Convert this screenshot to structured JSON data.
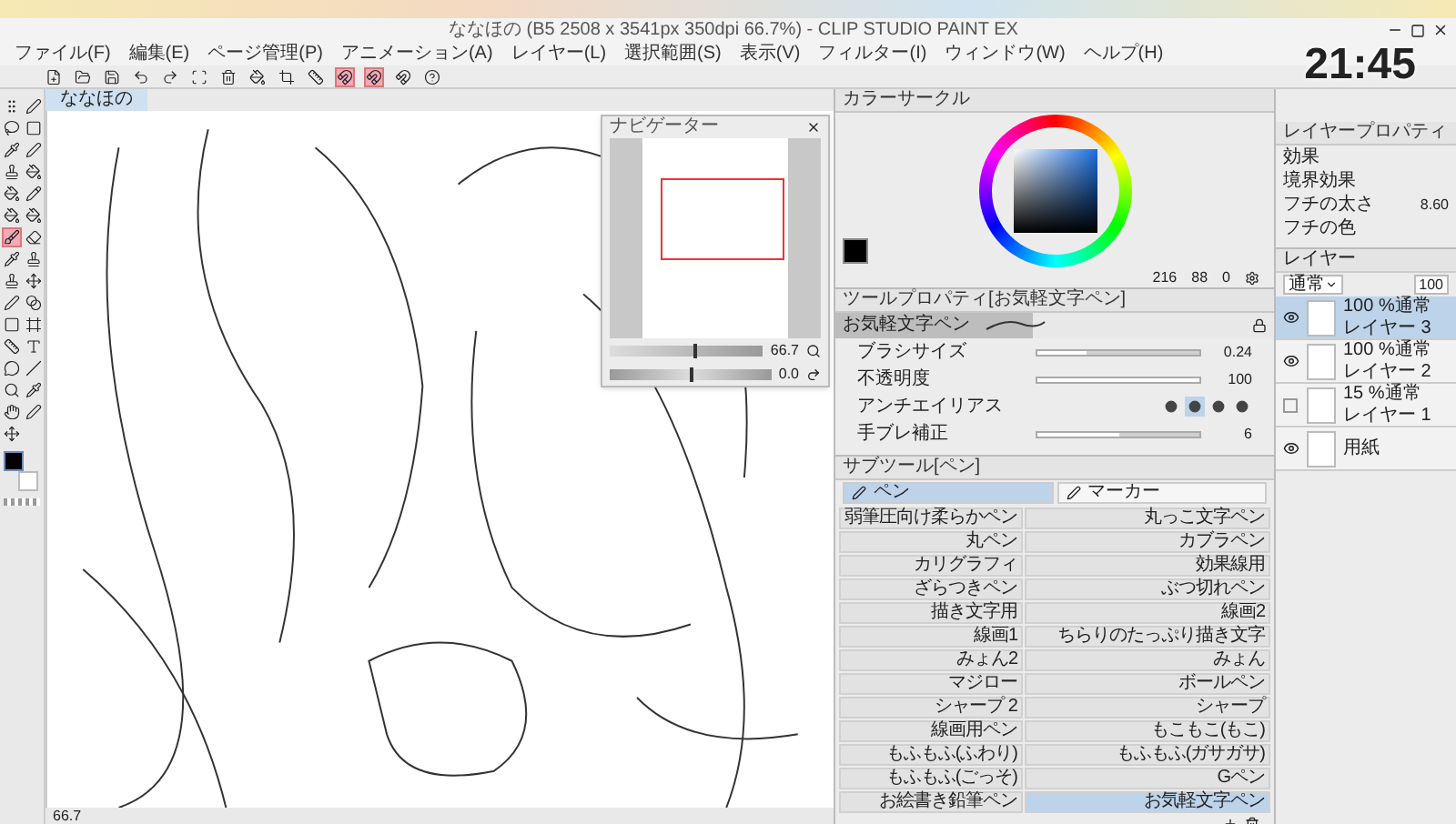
{
  "window": {
    "title": "ななほの (B5 2508 x 3541px 350dpi 66.7%) - CLIP STUDIO PAINT EX"
  },
  "clock": "21:45",
  "menu": [
    "ファイル(F)",
    "編集(E)",
    "ページ管理(P)",
    "アニメーション(A)",
    "レイヤー(L)",
    "選択範囲(S)",
    "表示(V)",
    "フィルター(I)",
    "ウィンドウ(W)",
    "ヘルプ(H)"
  ],
  "toolbar": [
    {
      "kind": "new",
      "selected": false
    },
    {
      "kind": "open",
      "selected": false
    },
    {
      "kind": "save",
      "selected": false
    },
    {
      "kind": "undo",
      "selected": false
    },
    {
      "kind": "redo",
      "selected": false
    },
    {
      "kind": "transform",
      "selected": false
    },
    {
      "kind": "clear",
      "selected": false
    },
    {
      "kind": "fill",
      "selected": false
    },
    {
      "kind": "crop",
      "selected": false
    },
    {
      "kind": "ruler",
      "selected": false
    },
    {
      "kind": "snap",
      "selected": true
    },
    {
      "kind": "snap",
      "selected": true
    },
    {
      "kind": "snap",
      "selected": false
    },
    {
      "kind": "help",
      "selected": false
    }
  ],
  "tools": [
    {
      "kind": "grip",
      "selected": false
    },
    {
      "kind": "pen",
      "selected": false
    },
    {
      "kind": "lasso",
      "selected": false
    },
    {
      "kind": "rect",
      "selected": false
    },
    {
      "kind": "pipette",
      "selected": false
    },
    {
      "kind": "pen",
      "selected": false
    },
    {
      "kind": "stamp",
      "selected": false
    },
    {
      "kind": "fill",
      "selected": false
    },
    {
      "kind": "fill",
      "selected": false
    },
    {
      "kind": "pencil",
      "selected": false
    },
    {
      "kind": "fill",
      "selected": false
    },
    {
      "kind": "fill",
      "selected": false
    },
    {
      "kind": "brush",
      "selected": true
    },
    {
      "kind": "eraser",
      "selected": false
    },
    {
      "kind": "pipette",
      "selected": false
    },
    {
      "kind": "stamp",
      "selected": false
    },
    {
      "kind": "stamp",
      "selected": false
    },
    {
      "kind": "move",
      "selected": false
    },
    {
      "kind": "pen",
      "selected": false
    },
    {
      "kind": "gradient",
      "selected": false
    },
    {
      "kind": "rect",
      "selected": false
    },
    {
      "kind": "frame",
      "selected": false
    },
    {
      "kind": "ruler",
      "selected": false
    },
    {
      "kind": "text",
      "selected": false
    },
    {
      "kind": "balloon",
      "selected": false
    },
    {
      "kind": "line",
      "selected": false
    },
    {
      "kind": "zoom",
      "selected": false
    },
    {
      "kind": "pipette",
      "selected": false
    },
    {
      "kind": "hand",
      "selected": false
    },
    {
      "kind": "pen",
      "selected": false
    },
    {
      "kind": "move",
      "selected": false
    }
  ],
  "canvas": {
    "tab": "ななほの",
    "zoom": "66.7"
  },
  "navigator": {
    "title": "ナビゲーター",
    "zoom_slider": {
      "level": 0.55
    },
    "zoom": "66.7",
    "rotate_slider": {
      "level": 0.5
    },
    "angle": "0.0"
  },
  "color_circle": {
    "title": "カラーサークル",
    "values": [
      "216",
      "88",
      "0"
    ]
  },
  "tool_property": {
    "title": "ツールプロパティ[お気軽文字ペン]",
    "brush_name": "お気軽文字ペン",
    "settings": [
      {
        "kind": "slider",
        "label": "ブラシサイズ",
        "value": "0.24",
        "level": 0.3
      },
      {
        "kind": "slider",
        "label": "不透明度",
        "value": "100",
        "level": 1
      },
      {
        "kind": "choice",
        "label": "アンチエイリアス",
        "options": [
          {
            "selected": false
          },
          {
            "selected": true
          },
          {
            "selected": false
          },
          {
            "selected": false
          }
        ]
      },
      {
        "kind": "slider",
        "label": "手ブレ補正",
        "value": "6",
        "level": 0.5
      }
    ]
  },
  "sub_tool": {
    "title": "サブツール[ペン]",
    "tabs": [
      {
        "label": "ペン",
        "selected": true
      },
      {
        "label": "マーカー",
        "selected": false
      }
    ],
    "brushes": [
      {
        "label": "弱筆圧向け柔らかペン",
        "selected": false
      },
      {
        "label": "丸っこ文字ペン",
        "selected": false
      },
      {
        "label": "丸ペン",
        "selected": false
      },
      {
        "label": "カブラペン",
        "selected": false
      },
      {
        "label": "カリグラフィ",
        "selected": false
      },
      {
        "label": "効果線用",
        "selected": false
      },
      {
        "label": "ざらつきペン",
        "selected": false
      },
      {
        "label": "ぶつ切れペン",
        "selected": false
      },
      {
        "label": "描き文字用",
        "selected": false
      },
      {
        "label": "線画2",
        "selected": false
      },
      {
        "label": "線画1",
        "selected": false
      },
      {
        "label": "ちらりのたっぷり描き文字",
        "selected": false
      },
      {
        "label": "みょん2",
        "selected": false
      },
      {
        "label": "みょん",
        "selected": false
      },
      {
        "label": "マジロー",
        "selected": false
      },
      {
        "label": "ボールペン",
        "selected": false
      },
      {
        "label": "シャープ 2",
        "selected": false
      },
      {
        "label": "シャープ",
        "selected": false
      },
      {
        "label": "線画用ペン",
        "selected": false
      },
      {
        "label": "もこもこ(もこ)",
        "selected": false
      },
      {
        "label": "もふもふ(ふわり)",
        "selected": false
      },
      {
        "label": "もふもふ(ガサガサ)",
        "selected": false
      },
      {
        "label": "もふもふ(ごっそ)",
        "selected": false
      },
      {
        "label": "Gペン",
        "selected": false
      },
      {
        "label": "お絵書き鉛筆ペン",
        "selected": false
      },
      {
        "label": "お気軽文字ペン",
        "selected": true
      }
    ]
  },
  "layer_property": {
    "title": "レイヤープロパティ",
    "rows": [
      {
        "label": "効果"
      },
      {
        "label": "境界効果"
      },
      {
        "label": "フチの太さ",
        "value": "8.60"
      },
      {
        "label": "フチの色"
      }
    ]
  },
  "layers": {
    "tab": "レイヤー",
    "blend_mode": "通常",
    "opacity": "100",
    "items": [
      {
        "mode": "100 %通常",
        "name": "レイヤー 3",
        "visible": true,
        "selected": true
      },
      {
        "mode": "100 %通常",
        "name": "レイヤー 2",
        "visible": true,
        "selected": false
      },
      {
        "mode": "15 %通常",
        "name": "レイヤー 1",
        "visible": false,
        "selected": false
      },
      {
        "name": "用紙",
        "visible": true,
        "selected": false
      }
    ]
  }
}
